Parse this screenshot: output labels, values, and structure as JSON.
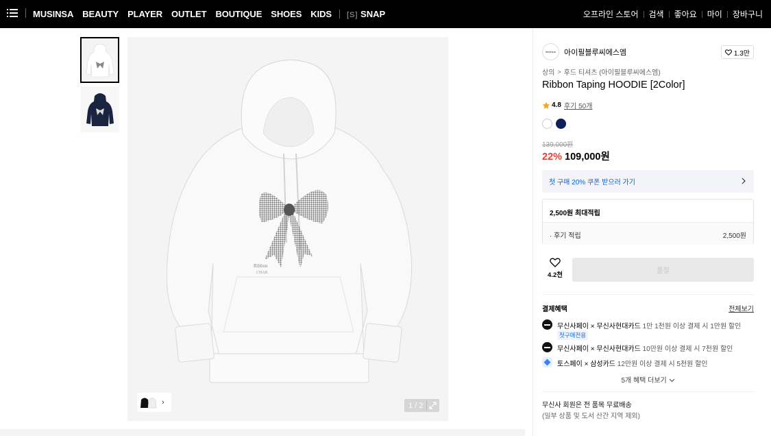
{
  "nav": {
    "left_items": [
      "MUSINSA",
      "BEAUTY",
      "PLAYER",
      "OUTLET",
      "BOUTIQUE",
      "SHOES",
      "KIDS"
    ],
    "snap_prefix": "[S]",
    "snap_label": "SNAP",
    "right_items": [
      "오프라인 스토어",
      "검색",
      "좋아요",
      "마이",
      "장바구니"
    ]
  },
  "gallery": {
    "counter": "1 / 2"
  },
  "product": {
    "brand": "아이필블루씨에스엠",
    "brand_logo_text": "ifeelblue",
    "brand_likes": "1.3만",
    "breadcrumb": [
      "상의",
      "후드 티셔츠 (아이필블루씨에스엠)"
    ],
    "title": "Ribbon Taping HOODIE [2Color]",
    "rating": "4.8",
    "reviews": "후기 50개",
    "colors": [
      "#ffffff",
      "#0e1f5b"
    ],
    "original_price": "139,000원",
    "discount": "22%",
    "price": "109,000원",
    "coupon": "첫 구매 20% 쿠폰 받으러 가기",
    "points": {
      "header": "2,500원 최대적립",
      "review_label": "· 후기 적립",
      "review_value": "2,500원"
    },
    "wish_count": "4.2천",
    "buy_label": "품절"
  },
  "benefits": {
    "title": "결제혜택",
    "view_all": "전체보기",
    "items": [
      {
        "name": "무신사페이 × 무신사현대카드",
        "desc": "1만 1천원 이상 결제 시 1만원 할인",
        "badge": "첫구매전용"
      },
      {
        "name": "무신사페이 × 무신사현대카드",
        "desc": "10만원 이상 결제 시 7천원 할인"
      },
      {
        "name": "토스페이 × 삼성카드",
        "desc": "12만원 이상 결제 시 5천원 할인"
      }
    ],
    "more": "5개 혜택 더보기"
  },
  "shipping": {
    "line1": "무신사 회원은 전 품목 무료배송",
    "line2": "(일부 상품 및 도서 산간 지역 제외)"
  }
}
